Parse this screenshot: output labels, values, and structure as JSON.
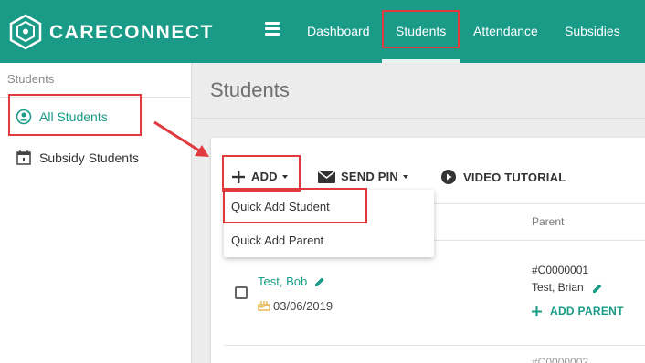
{
  "header": {
    "brand": "CARECONNECT",
    "menu_icon": "hamburger-icon",
    "nav": [
      "Dashboard",
      "Students",
      "Attendance",
      "Subsidies"
    ],
    "active_nav": "Students"
  },
  "sidebar": {
    "title": "Students",
    "items": [
      {
        "label": "All Students",
        "icon": "user-circle-icon",
        "active": true
      },
      {
        "label": "Subsidy Students",
        "icon": "calendar-icon",
        "active": false
      }
    ]
  },
  "main": {
    "title": "Students",
    "toolbar": {
      "add_label": "ADD",
      "send_pin_label": "SEND PIN",
      "video_label": "VIDEO TUTORIAL"
    },
    "add_menu": [
      "Quick Add Student",
      "Quick Add Parent"
    ],
    "columns": {
      "parent": "Parent"
    },
    "rows": [
      {
        "student_name": "Test, Bob",
        "birthday": "03/06/2019",
        "parent_id": "#C0000001",
        "parent_name": "Test, Brian",
        "add_parent_label": "ADD PARENT"
      },
      {
        "parent_id": "#C0000002"
      }
    ]
  },
  "colors": {
    "brand": "#1a9b87",
    "annotation": "#e0393e"
  }
}
